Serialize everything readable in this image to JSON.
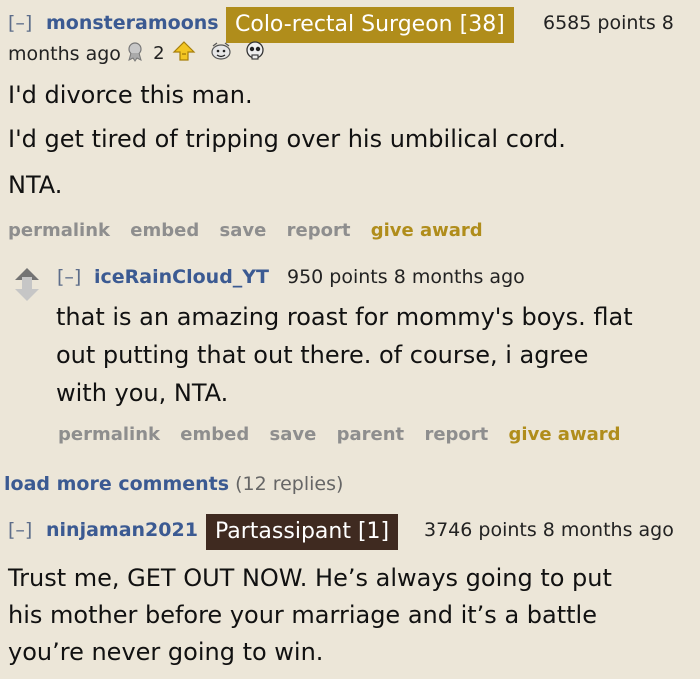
{
  "comment1": {
    "toggle": "[–]",
    "username": "monsteramoons",
    "flair": "Colo-rectal Surgeon [38]",
    "flair_color": "#b08d1b",
    "meta_line1": "6585 points 8",
    "meta_line2": "months ago",
    "award_count": "2",
    "body": [
      "I'd divorce this man.",
      "I'd get tired of tripping over his umbilical cord.",
      "NTA."
    ],
    "actions": [
      "permalink",
      "embed",
      "save",
      "report"
    ],
    "give_award": "give award"
  },
  "reply1": {
    "toggle": "[–]",
    "username": "iceRainCloud_YT",
    "meta": "950 points 8 months ago",
    "body": [
      "that is an amazing roast for mommy's boys. flat",
      "out putting that out there. of course, i agree",
      "with you, NTA."
    ],
    "actions": [
      "permalink",
      "embed",
      "save",
      "parent",
      "report"
    ],
    "give_award": "give award"
  },
  "load_more": {
    "label": "load more comments",
    "count": "(12 replies)"
  },
  "comment2": {
    "toggle": "[–]",
    "username": "ninjaman2021",
    "flair": "Partassipant [1]",
    "flair_color": "#3f2a20",
    "meta": "3746 points 8 months ago",
    "body": [
      "Trust me, GET OUT NOW. He’s always going to put",
      "his mother before your marriage and it’s a battle",
      "you’re never going to win."
    ]
  }
}
